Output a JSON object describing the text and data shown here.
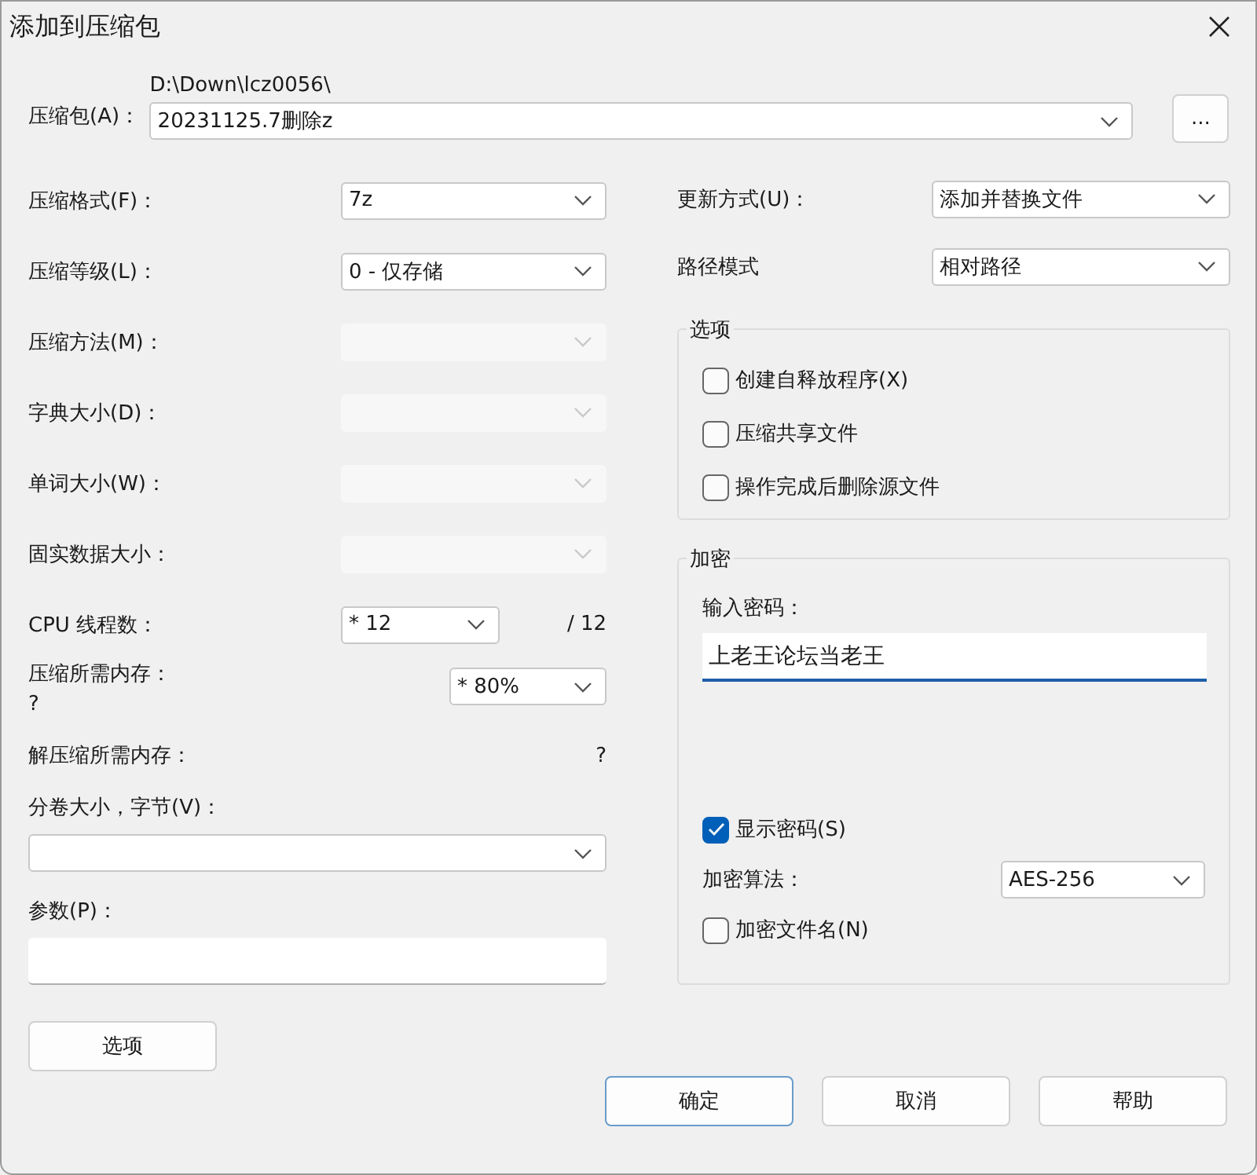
{
  "window": {
    "title": "添加到压缩包"
  },
  "archive": {
    "label": "压缩包(A)：",
    "path": "D:\\Down\\lcz0056\\",
    "value": "20231125.7删除z",
    "browse": "..."
  },
  "left_settings": [
    {
      "kind": "combo",
      "label": "压缩格式(F)：",
      "value": "7z",
      "disabled": false
    },
    {
      "kind": "combo",
      "label": "压缩等级(L)：",
      "value": "0 - 仅存储",
      "disabled": false
    },
    {
      "kind": "combo",
      "label": "压缩方法(M)：",
      "disabled": true
    },
    {
      "kind": "combo",
      "label": "字典大小(D)：",
      "disabled": true
    },
    {
      "kind": "combo",
      "label": "单词大小(W)：",
      "disabled": true
    },
    {
      "kind": "combo",
      "label": "固实数据大小：",
      "disabled": true
    },
    {
      "kind": "threads",
      "label": "CPU 线程数：",
      "value": "*  12",
      "total": "/ 12"
    },
    {
      "kind": "memory",
      "label": "压缩所需内存：",
      "note": "?",
      "value": "* 80%"
    },
    {
      "kind": "info",
      "label": "解压缩所需内存：",
      "value": "?"
    }
  ],
  "volume": {
    "label": "分卷大小，字节(V)："
  },
  "parameters": {
    "label": "参数(P)："
  },
  "options_button": "选项",
  "right_settings": [
    {
      "label": "更新方式(U)：",
      "value": "添加并替换文件"
    },
    {
      "label": "路径模式",
      "value": "相对路径"
    }
  ],
  "options_group": {
    "title": "选项",
    "checkboxes": [
      {
        "label": "创建自释放程序(X)",
        "checked": false
      },
      {
        "label": "压缩共享文件",
        "checked": false
      },
      {
        "label": "操作完成后删除源文件",
        "checked": false
      }
    ]
  },
  "encryption": {
    "title": "加密",
    "password_label": "输入密码：",
    "password": "上老王论坛当老王",
    "show_password": {
      "label": "显示密码(S)",
      "checked": true
    },
    "method": {
      "label": "加密算法：",
      "value": "AES-256"
    },
    "encrypt_names": {
      "label": "加密文件名(N)",
      "checked": false
    }
  },
  "buttons": [
    {
      "label": "确定",
      "default": true
    },
    {
      "label": "取消",
      "default": false
    },
    {
      "label": "帮助",
      "default": false
    }
  ]
}
